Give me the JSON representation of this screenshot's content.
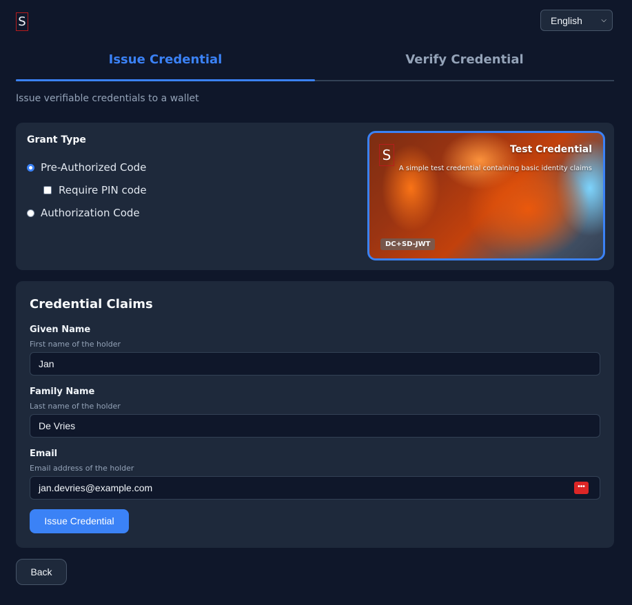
{
  "header": {
    "logo_letter": "S",
    "language": "English"
  },
  "tabs": [
    {
      "label": "Issue Credential",
      "active": true
    },
    {
      "label": "Verify Credential",
      "active": false
    }
  ],
  "subtitle": "Issue verifiable credentials to a wallet",
  "grant": {
    "title": "Grant Type",
    "options": [
      {
        "label": "Pre-Authorized Code",
        "selected": true
      },
      {
        "label": "Authorization Code",
        "selected": false
      }
    ],
    "pin_label": "Require PIN code",
    "pin_checked": false
  },
  "credential_card": {
    "logo_letter": "S",
    "title": "Test Credential",
    "description": "A simple test credential containing basic identity claims",
    "format": "DC+SD-JWT"
  },
  "claims": {
    "title": "Credential Claims",
    "fields": [
      {
        "label": "Given Name",
        "help": "First name of the holder",
        "value": "Jan"
      },
      {
        "label": "Family Name",
        "help": "Last name of the holder",
        "value": "De Vries"
      },
      {
        "label": "Email",
        "help": "Email address of the holder",
        "value": "jan.devries@example.com"
      }
    ],
    "submit_label": "Issue Credential"
  },
  "back_label": "Back",
  "colors": {
    "background": "#0f172a",
    "card": "#1e293b",
    "accent": "#3b82f6"
  }
}
